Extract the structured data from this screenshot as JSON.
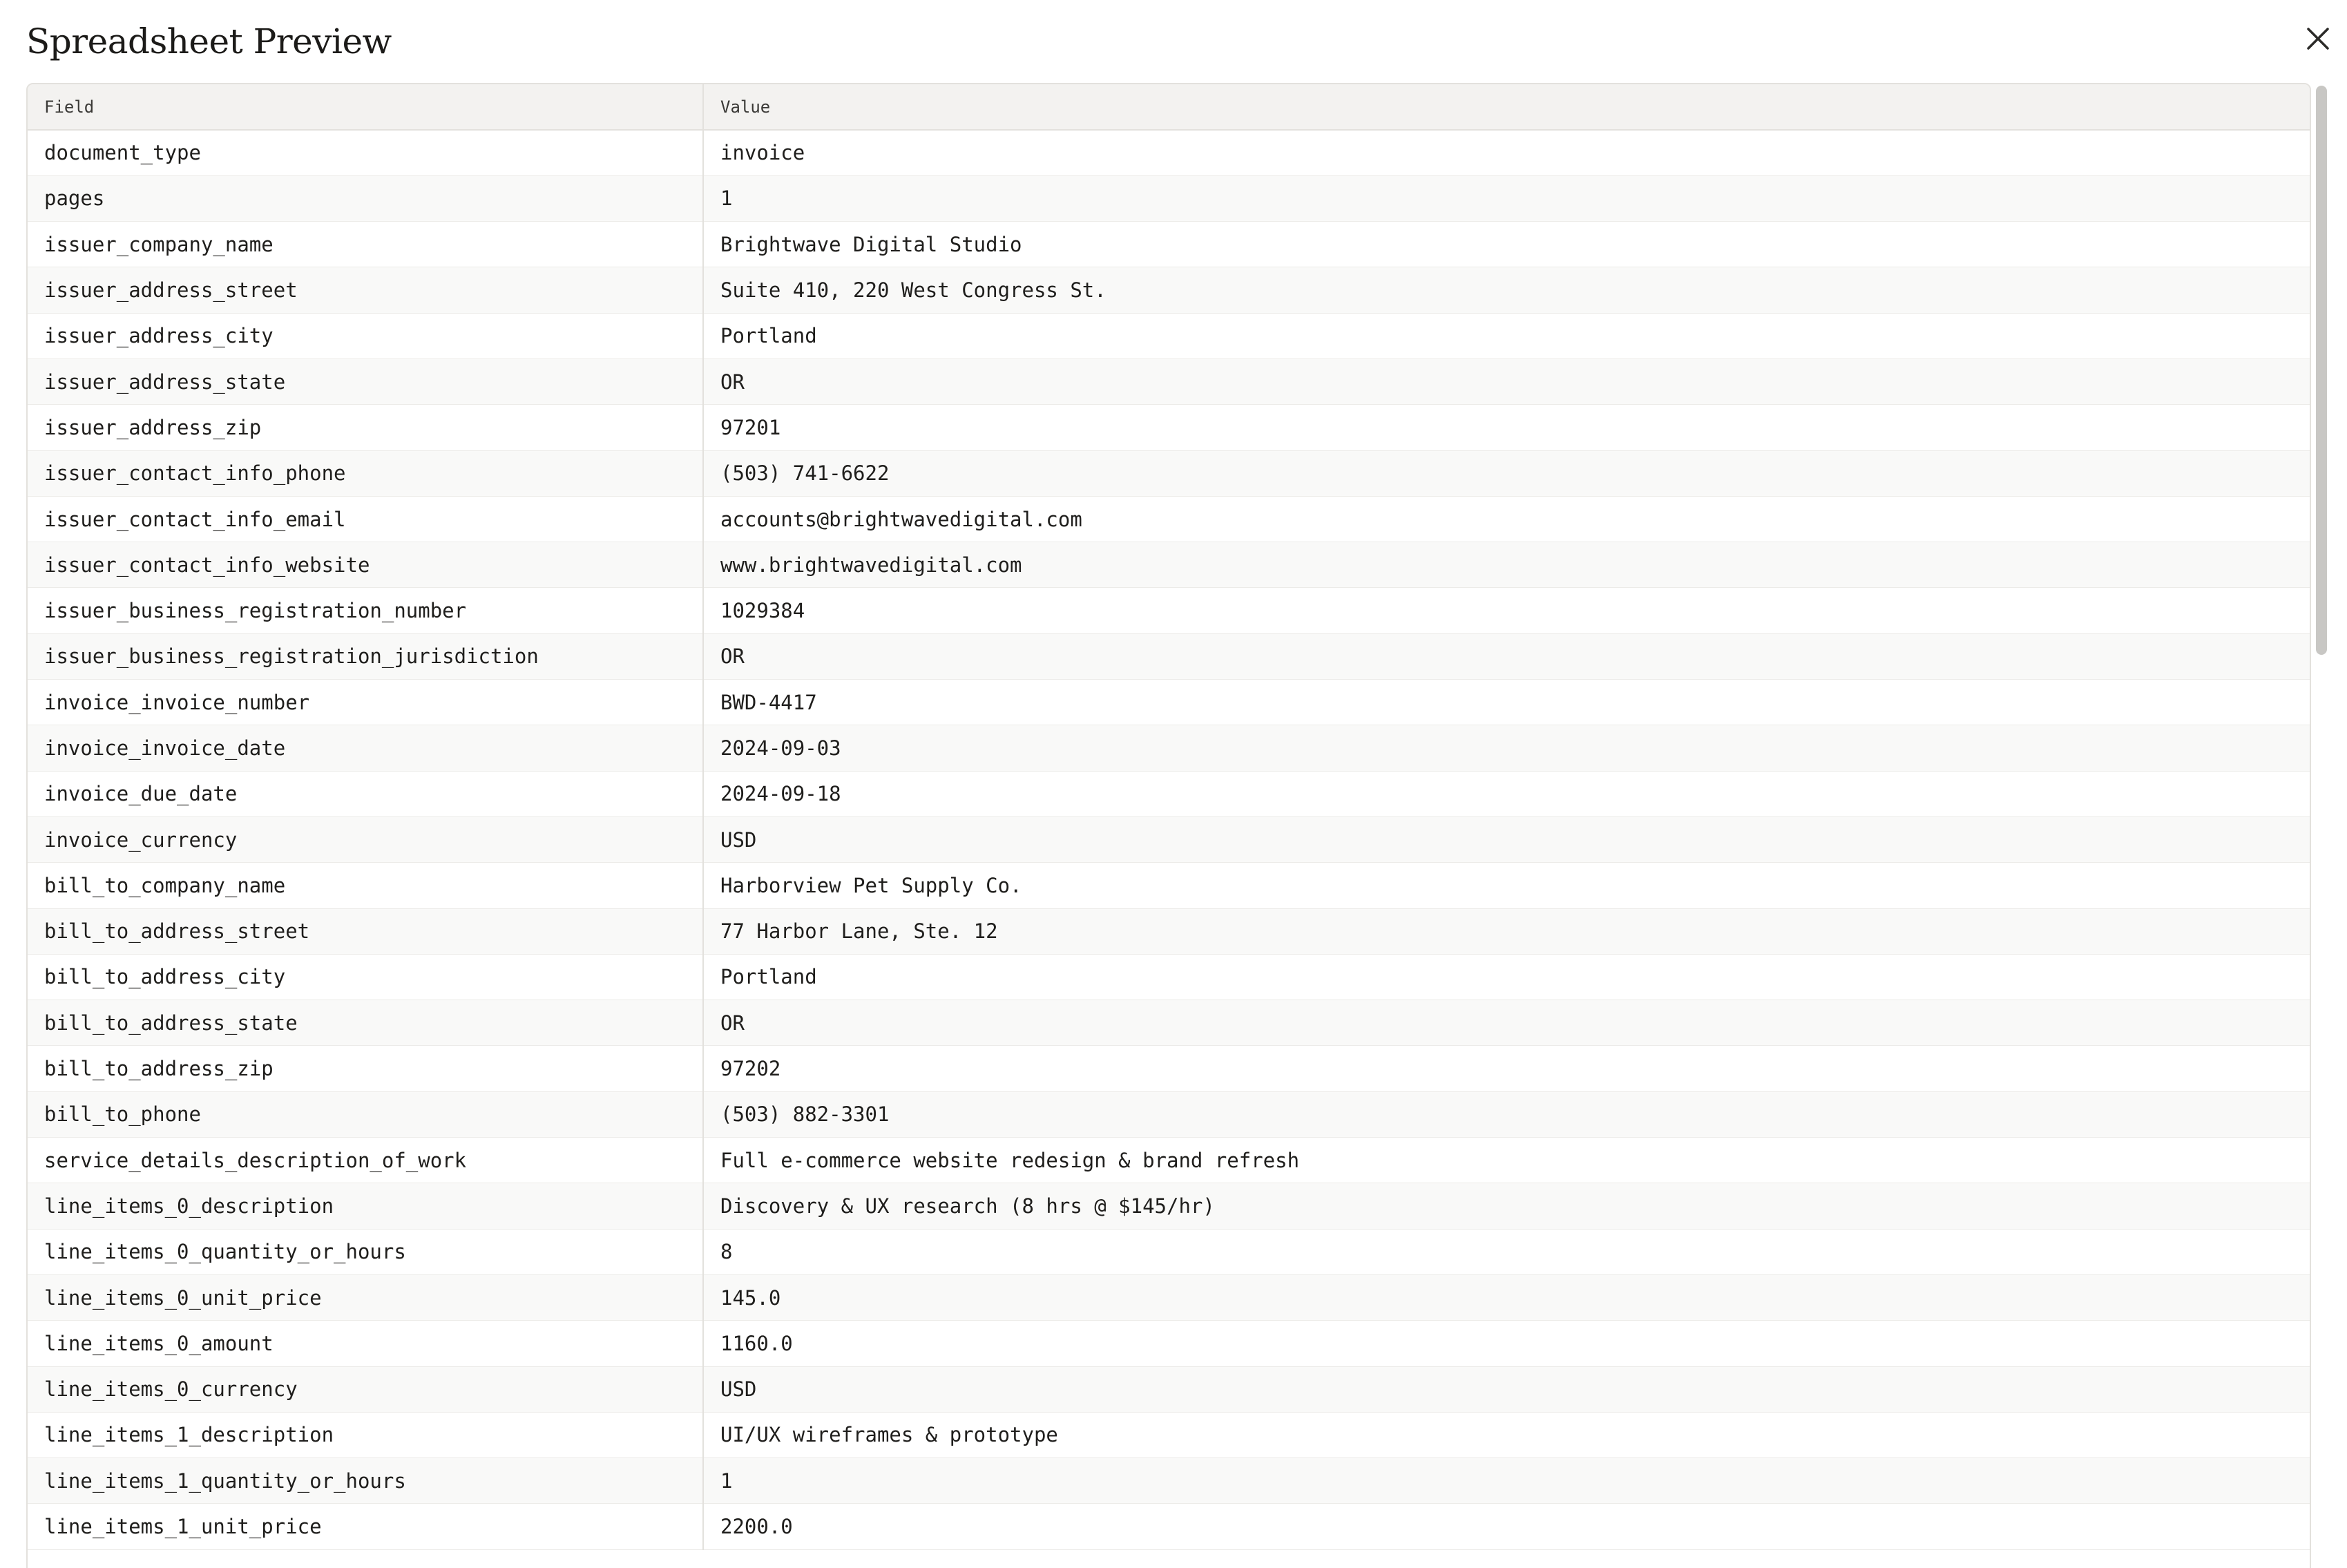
{
  "dialog": {
    "title": "Spreadsheet Preview",
    "close_icon": "close-icon"
  },
  "table": {
    "headers": [
      "Field",
      "Value"
    ],
    "rows": [
      [
        "document_type",
        "invoice"
      ],
      [
        "pages",
        "1"
      ],
      [
        "issuer_company_name",
        "Brightwave Digital Studio"
      ],
      [
        "issuer_address_street",
        "Suite 410, 220 West Congress St."
      ],
      [
        "issuer_address_city",
        "Portland"
      ],
      [
        "issuer_address_state",
        "OR"
      ],
      [
        "issuer_address_zip",
        "97201"
      ],
      [
        "issuer_contact_info_phone",
        "(503) 741-6622"
      ],
      [
        "issuer_contact_info_email",
        "accounts@brightwavedigital.com"
      ],
      [
        "issuer_contact_info_website",
        "www.brightwavedigital.com"
      ],
      [
        "issuer_business_registration_number",
        "1029384"
      ],
      [
        "issuer_business_registration_jurisdiction",
        "OR"
      ],
      [
        "invoice_invoice_number",
        "BWD-4417"
      ],
      [
        "invoice_invoice_date",
        "2024-09-03"
      ],
      [
        "invoice_due_date",
        "2024-09-18"
      ],
      [
        "invoice_currency",
        "USD"
      ],
      [
        "bill_to_company_name",
        "Harborview Pet Supply Co."
      ],
      [
        "bill_to_address_street",
        "77 Harbor Lane, Ste. 12"
      ],
      [
        "bill_to_address_city",
        "Portland"
      ],
      [
        "bill_to_address_state",
        "OR"
      ],
      [
        "bill_to_address_zip",
        "97202"
      ],
      [
        "bill_to_phone",
        "(503) 882-3301"
      ],
      [
        "service_details_description_of_work",
        "Full e-commerce website redesign & brand refresh"
      ],
      [
        "line_items_0_description",
        "Discovery & UX research (8 hrs @ $145/hr)"
      ],
      [
        "line_items_0_quantity_or_hours",
        "8"
      ],
      [
        "line_items_0_unit_price",
        "145.0"
      ],
      [
        "line_items_0_amount",
        "1160.0"
      ],
      [
        "line_items_0_currency",
        "USD"
      ],
      [
        "line_items_1_description",
        "UI/UX wireframes & prototype"
      ],
      [
        "line_items_1_quantity_or_hours",
        "1"
      ],
      [
        "line_items_1_unit_price",
        "2200.0"
      ]
    ]
  }
}
